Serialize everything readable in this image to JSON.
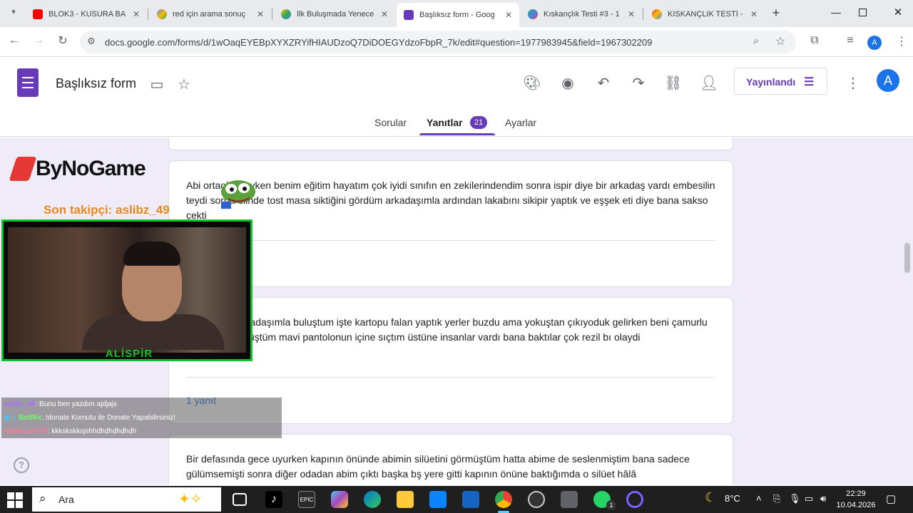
{
  "browser": {
    "tabs": [
      {
        "title": "BLOK3 - KUSURA BA",
        "icon": "youtube-icon",
        "color": "#ff0000"
      },
      {
        "title": "red için arama sonuç",
        "icon": "ai-icon",
        "color": "#4285f4"
      },
      {
        "title": "İlk Buluşmada Yenece",
        "icon": "ai-icon",
        "color": "#fbbc04"
      },
      {
        "title": "Başlıksız form - Goog",
        "icon": "forms-icon",
        "color": "#673ab7",
        "active": true
      },
      {
        "title": "Kıskançlık Testi #3 - 1",
        "icon": "ai-icon",
        "color": "#34a853"
      },
      {
        "title": "KISKANÇLIK TESTİ -",
        "icon": "ai-icon",
        "color": "#ea4335"
      }
    ],
    "new_tab": "+",
    "url": "docs.google.com/forms/d/1wOaqEYEBpXYXZRYifHIAUDzoQ7DiDOEGYdzoFbpR_7k/edit#question=1977983945&field=1967302209",
    "profile_initial": "A"
  },
  "form": {
    "title": "Başlıksız form",
    "publish_label": "Yayınlandı",
    "avatar_initial": "A",
    "tabs": {
      "questions": "Sorular",
      "responses": "Yanıtlar",
      "settings": "Ayarlar"
    },
    "response_count": "21",
    "answers": [
      {
        "text": "Abi ortaokuldayken benim eğitim hayatım çok iyidi sınıfın en zekilerindendim sonra ispir diye bir arkadaş vardı embesilin teydi sorna elinde tost masa siktiğini gördüm arkadaşımla ardından lakabını sikipir yaptık ve eşşek eti diye bana sakso çekti"
      },
      {
        "text": "Kışın evde arkadaşımla buluştum işte kartopu falan yaptık yerler buzdu ama yokuştan çıkıyoduk gelirken beni çamurlu kara ittirdi bı düştüm mavi pantolonun içine sıçtım üstüne insanlar vardı bana baktılar çok rezil bı olaydi",
        "responses": "1 yanıt"
      },
      {
        "text": "Bir defasında gece uyurken kapının önünde abimin silüetini görmüştüm hatta abime de seslenmiştim bana sadece gülümsemişti sonra diğer odadan abim çıktı başka bş yere gitti kapının önüne baktığımda o silüet hâlâ"
      }
    ]
  },
  "overlay": {
    "logo_text": "ByNoGame",
    "last_follower": "Son takipçi: aslibz_49",
    "streamer_name": "ALİSPİR",
    "chat": [
      {
        "user": "aslibz_49",
        "user_color": "#a970ff",
        "message": ": Bunu ben yazdım ajdjajs"
      },
      {
        "user": "BotRix",
        "user_color": "#6bff6b",
        "message": ": !donate Komutu ile Donate Yapabilirsiniz!"
      },
      {
        "user": "Hallibasri776",
        "user_color": "#ff7b9c",
        "message": ": kkkskskksjshhdhdhdhdhdh"
      }
    ],
    "help": "?"
  },
  "taskbar": {
    "search_label": "Ara",
    "weather": "8°C",
    "time": "22:29",
    "date": "10.04.2026",
    "whatsapp_badge": "1"
  }
}
